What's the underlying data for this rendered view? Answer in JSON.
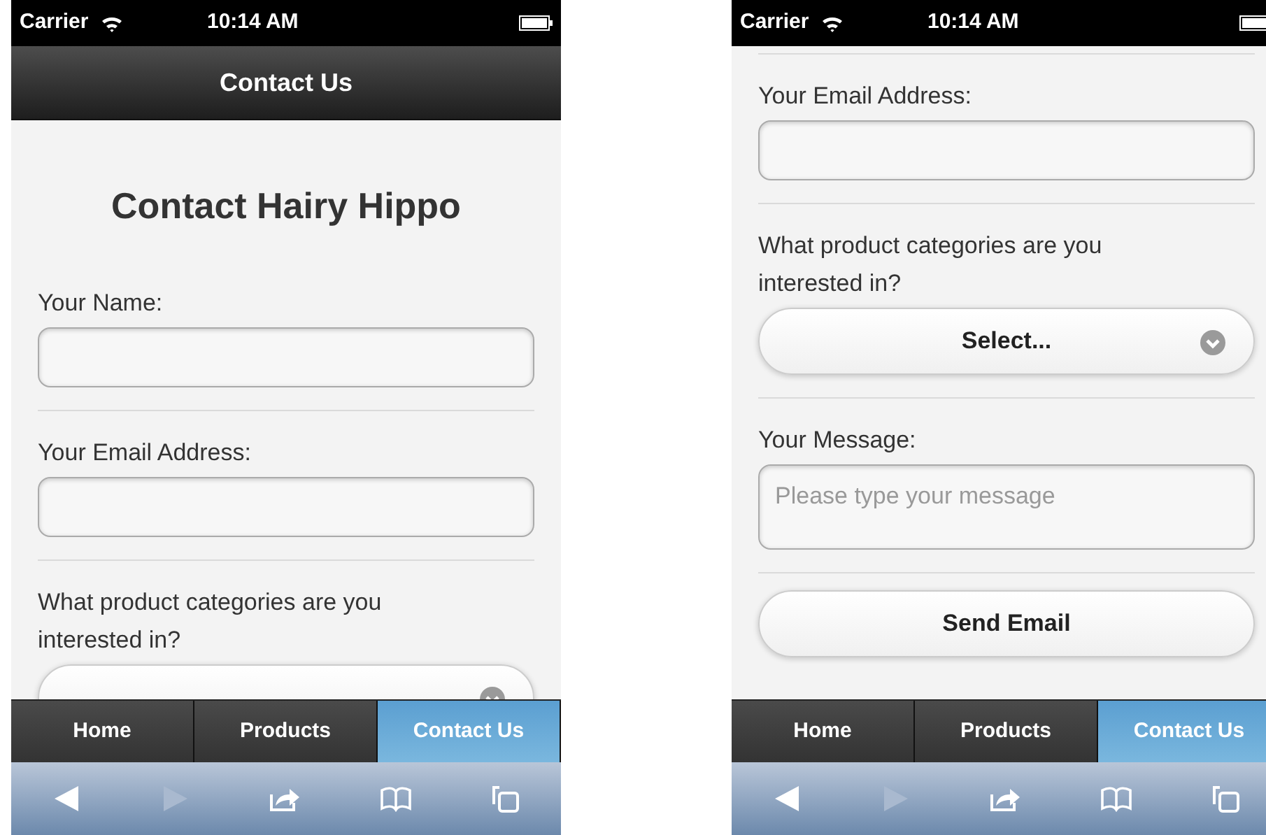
{
  "screens": [
    {
      "status_bar": {
        "carrier": "Carrier",
        "time": "10:14 AM"
      },
      "nav_bar": {
        "title": "Contact Us"
      },
      "content": [
        {
          "kind": "heading",
          "text": "Contact Hairy Hippo"
        },
        {
          "kind": "label",
          "text": "Your Name:"
        },
        {
          "kind": "input"
        },
        {
          "kind": "divider"
        },
        {
          "kind": "label",
          "text": "Your Email Address:"
        },
        {
          "kind": "input"
        },
        {
          "kind": "divider"
        },
        {
          "kind": "label",
          "text": "What product categories are you interested in?"
        },
        {
          "kind": "select"
        }
      ],
      "tabs": [
        {
          "label": "Home",
          "selected": false
        },
        {
          "label": "Products",
          "selected": false
        },
        {
          "label": "Contact Us",
          "selected": true
        }
      ],
      "toolbar": {
        "back_disabled": false,
        "forward_disabled": true
      }
    },
    {
      "status_bar": {
        "carrier": "Carrier",
        "time": "10:14 AM"
      },
      "content": [
        {
          "kind": "divider"
        },
        {
          "kind": "label",
          "text": "Your Email Address:"
        },
        {
          "kind": "input"
        },
        {
          "kind": "divider"
        },
        {
          "kind": "label",
          "text": "What product categories are you interested in?"
        },
        {
          "kind": "select",
          "text": "Select..."
        },
        {
          "kind": "divider"
        },
        {
          "kind": "label",
          "text": "Your Message:"
        },
        {
          "kind": "textarea",
          "placeholder": "Please type your message"
        },
        {
          "kind": "divider"
        },
        {
          "kind": "button",
          "text": "Send Email"
        }
      ],
      "tabs": [
        {
          "label": "Home",
          "selected": false
        },
        {
          "label": "Products",
          "selected": false
        },
        {
          "label": "Contact Us",
          "selected": true
        }
      ],
      "toolbar": {
        "back_disabled": false,
        "forward_disabled": true
      }
    }
  ]
}
